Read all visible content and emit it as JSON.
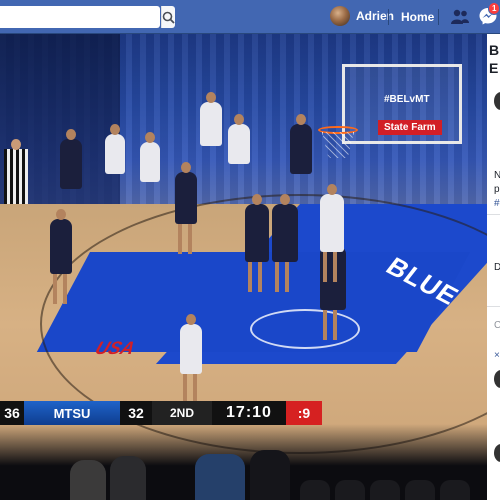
{
  "topbar": {
    "search_placeholder": "",
    "search_icon": "search-icon",
    "user_name": "Adrien",
    "home_label": "Home",
    "notification_count": "1",
    "brand_color": "#4267b2"
  },
  "video": {
    "backboard_text": "#BELvMT",
    "sponsor": "State Farm",
    "court_logo": "USA",
    "court_band_text": "BLUE",
    "scoreboard": {
      "away_score": "36",
      "team": "MTSU",
      "home_score": "32",
      "period": "2ND",
      "clock": "17:10",
      "shot_clock": ":9"
    }
  },
  "side_panel": {
    "heading_1": "B",
    "heading_2": "E",
    "line_n": "N",
    "line_p": "p",
    "hashtag": "#",
    "line_d": "D",
    "line_c": "C",
    "line_x": "×"
  }
}
